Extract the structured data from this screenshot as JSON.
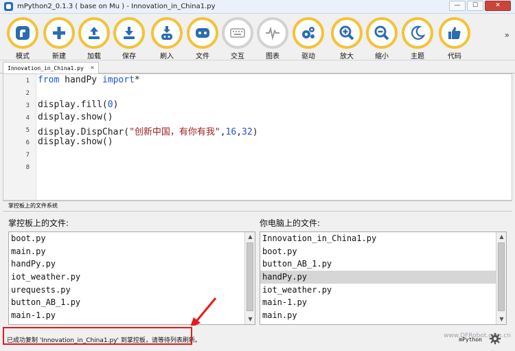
{
  "window": {
    "title": "mPython2_0.1.3 ( base on Mu ) - Innovation_in_China1.py",
    "min_label": "—",
    "max_label": "☐",
    "close_label": "✕"
  },
  "toolbar": {
    "items": [
      {
        "label": "模式",
        "icon": "mode-icon"
      },
      {
        "label": "新建",
        "icon": "plus-icon"
      },
      {
        "label": "加载",
        "icon": "upload-icon"
      },
      {
        "label": "保存",
        "icon": "download-icon"
      },
      {
        "label": "刷入",
        "icon": "flash-icon"
      },
      {
        "label": "文件",
        "icon": "board-icon"
      },
      {
        "label": "交互",
        "icon": "keyboard-icon"
      },
      {
        "label": "图表",
        "icon": "pulse-icon"
      },
      {
        "label": "驱动",
        "icon": "gears-icon"
      },
      {
        "label": "放大",
        "icon": "zoom-in-icon"
      },
      {
        "label": "缩小",
        "icon": "zoom-out-icon"
      },
      {
        "label": "主题",
        "icon": "moon-icon"
      },
      {
        "label": "代码",
        "icon": "thumbs-up-icon"
      }
    ],
    "more": "»"
  },
  "tab": {
    "label": "Innovation_in_China1.py",
    "close": "✕"
  },
  "editor": {
    "line_numbers": [
      "1",
      "2",
      "3",
      "4",
      "5",
      "6",
      "7",
      "8"
    ],
    "line1": {
      "kw1": "from",
      "mod": " handPy ",
      "kw2": "import",
      "star": "*"
    },
    "line3": {
      "pre": "display.fill(",
      "num": "0",
      "post": ")"
    },
    "line4": {
      "text": "display.show()"
    },
    "line5": {
      "pre": "display.DispChar(",
      "str": "\"创新中国，有你有我\"",
      "sep1": ",",
      "num1": "16",
      "sep2": ",",
      "num2": "32",
      "post": ")"
    },
    "line6": {
      "text": "display.show()"
    }
  },
  "fs": {
    "header": "掌控板上的文件系统",
    "left_title": "掌控板上的文件:",
    "right_title": "你电脑上的文件:",
    "left_files": [
      "boot.py",
      "main.py",
      "handPy.py",
      "iot_weather.py",
      "urequests.py",
      "button_AB_1.py",
      "main-1.py"
    ],
    "right_files": [
      "Innovation_in_China1.py",
      "boot.py",
      "button_AB_1.py",
      "handPy.py",
      "iot_weather.py",
      "main-1.py",
      "main.py"
    ],
    "right_selected_index": 3
  },
  "status": {
    "message": "已成功复制 'Innovation_in_China1.py' 到掌控板，请等待列表刷新。",
    "mode": "mPython",
    "watermark": "www.DFRobot.com.cn"
  },
  "colors": {
    "accent": "#f4c23a",
    "highlight": "#e61a1a",
    "keyword": "#1f4fd6",
    "string": "#9c1b1b"
  }
}
